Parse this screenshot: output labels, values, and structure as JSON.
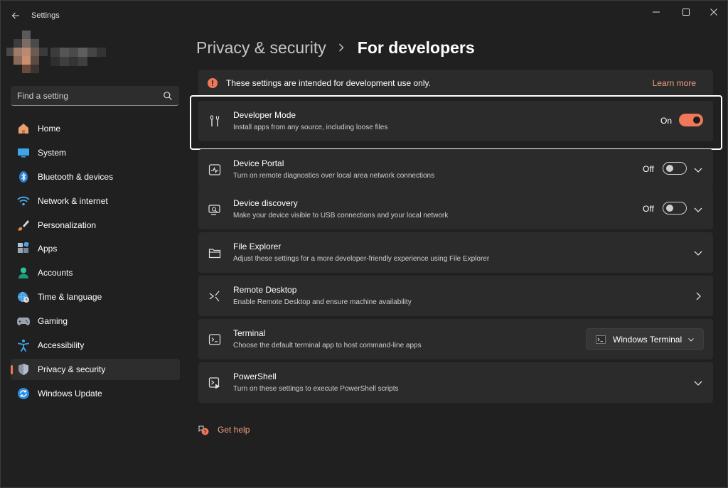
{
  "window": {
    "title": "Settings"
  },
  "search": {
    "placeholder": "Find a setting"
  },
  "sidebar": {
    "items": [
      {
        "label": "Home",
        "icon": "home-icon"
      },
      {
        "label": "System",
        "icon": "system-icon"
      },
      {
        "label": "Bluetooth & devices",
        "icon": "bluetooth-icon"
      },
      {
        "label": "Network & internet",
        "icon": "wifi-icon"
      },
      {
        "label": "Personalization",
        "icon": "brush-icon"
      },
      {
        "label": "Apps",
        "icon": "apps-icon"
      },
      {
        "label": "Accounts",
        "icon": "person-icon"
      },
      {
        "label": "Time & language",
        "icon": "globe-clock-icon"
      },
      {
        "label": "Gaming",
        "icon": "gamepad-icon"
      },
      {
        "label": "Accessibility",
        "icon": "accessibility-icon"
      },
      {
        "label": "Privacy & security",
        "icon": "shield-icon",
        "active": true
      },
      {
        "label": "Windows Update",
        "icon": "update-icon"
      }
    ]
  },
  "breadcrumb": {
    "parent": "Privacy & security",
    "current": "For developers"
  },
  "info": {
    "text": "These settings are intended for development use only.",
    "link": "Learn more"
  },
  "cards": [
    {
      "title": "Developer Mode",
      "desc": "Install apps from any source, including loose files",
      "icon": "tools-icon",
      "state": "On"
    },
    {
      "title": "Device Portal",
      "desc": "Turn on remote diagnostics over local area network connections",
      "icon": "pulse-monitor-icon",
      "state": "Off"
    },
    {
      "title": "Device discovery",
      "desc": "Make your device visible to USB connections and your local network",
      "icon": "device-search-icon",
      "state": "Off"
    },
    {
      "title": "File Explorer",
      "desc": "Adjust these settings for a more developer-friendly experience using File Explorer",
      "icon": "folder-icon"
    },
    {
      "title": "Remote Desktop",
      "desc": "Enable Remote Desktop and ensure machine availability",
      "icon": "remote-desktop-icon"
    },
    {
      "title": "Terminal",
      "desc": "Choose the default terminal app to host command-line apps",
      "icon": "terminal-icon",
      "dropdown_value": "Windows Terminal"
    },
    {
      "title": "PowerShell",
      "desc": "Turn on these settings to execute PowerShell scripts",
      "icon": "powershell-icon"
    }
  ],
  "help": {
    "link": "Get help"
  },
  "colors": {
    "accent": "#f0785a",
    "link": "#f0a080",
    "background": "#202020",
    "card": "#2b2b2b"
  }
}
